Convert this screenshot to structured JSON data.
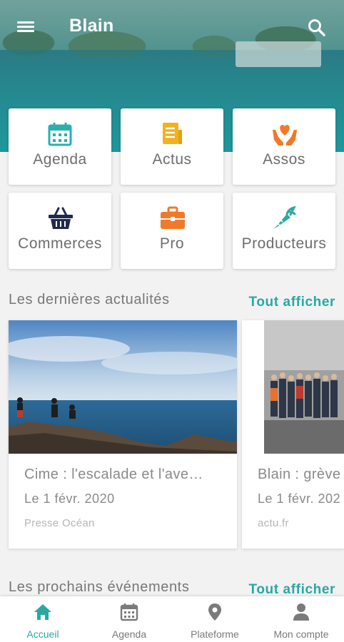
{
  "app": {
    "title": "Blain"
  },
  "colors": {
    "accent": "#2aa8a3",
    "agenda": "#29b0ad",
    "actus": "#f2b21c",
    "assos": "#f07a2a",
    "commerces": "#1f2b4d",
    "pro": "#f07a2a",
    "producteurs": "#2aa8a3"
  },
  "tiles": [
    {
      "label": "Agenda",
      "icon": "calendar-icon"
    },
    {
      "label": "Actus",
      "icon": "news-icon"
    },
    {
      "label": "Assos",
      "icon": "heart-hands-icon"
    },
    {
      "label": "Commerces",
      "icon": "basket-icon"
    },
    {
      "label": "Pro",
      "icon": "briefcase-icon"
    },
    {
      "label": "Producteurs",
      "icon": "carrot-icon"
    }
  ],
  "news": {
    "title": "Les dernières actualités",
    "link": "Tout afficher",
    "items": [
      {
        "title": "Cime : l'escalade et l'ave…",
        "date": "Le  1 févr. 2020",
        "source": "Presse Océan"
      },
      {
        "title": "Blain : grève",
        "date": "Le  1 févr. 202",
        "source": "actu.fr"
      }
    ]
  },
  "events": {
    "title": "Les prochains événements",
    "link": "Tout afficher"
  },
  "nav": [
    {
      "label": "Accueil",
      "icon": "home-icon",
      "active": true
    },
    {
      "label": "Agenda",
      "icon": "calendar-icon"
    },
    {
      "label": "Plateforme",
      "icon": "location-pin-icon"
    },
    {
      "label": "Mon compte",
      "icon": "user-icon"
    }
  ]
}
